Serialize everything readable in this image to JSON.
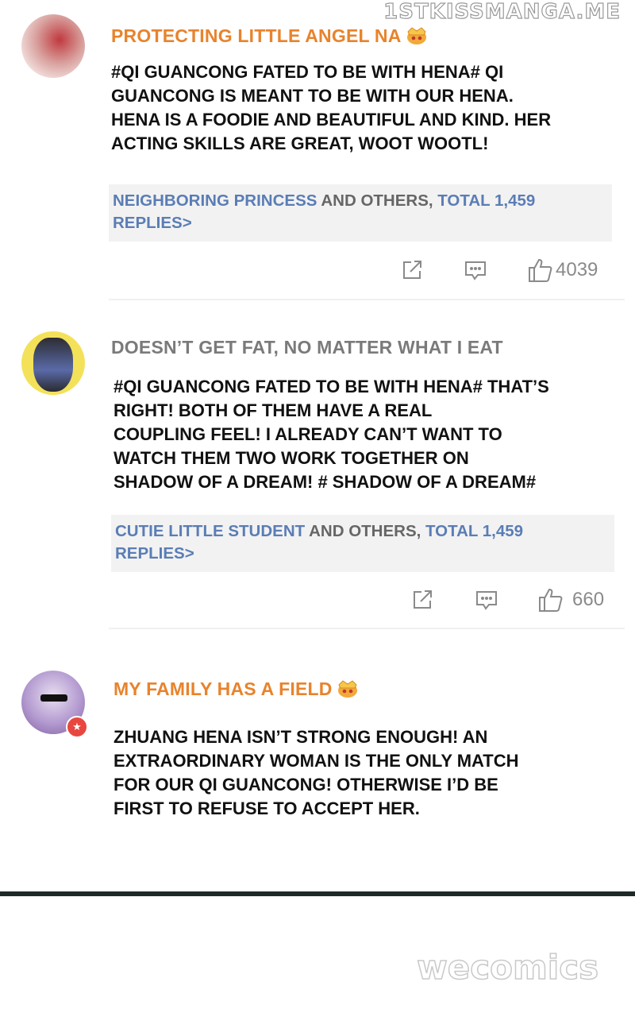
{
  "watermark": "1STKISSMANGA.ME",
  "logo": "wecomics",
  "colors": {
    "vip_name": "#e8832c",
    "normal_name": "#7a7a7a",
    "link": "#5a7db5",
    "reply_bg": "#f2f2f2"
  },
  "posts": [
    {
      "username": "PROTECTING LITTLE ANGEL NA",
      "badge": "crown-icon",
      "text": [
        "#QI GUANCONG FATED TO BE WITH HENA# QI",
        "GUANCONG IS MEANT TO BE WITH OUR HENA.",
        "HENA IS A FOODIE AND BEAUTIFUL AND KIND. HER",
        "ACTING SKILLS ARE GREAT, WOOT WOOTL!"
      ],
      "replies": {
        "user": "NEIGHBORING PRINCESS",
        "middle": " AND OTHERS, ",
        "total": "TOTAL 1,459",
        "tail": "REPLIES>"
      },
      "likes": "4039"
    },
    {
      "username": "DOESN’T GET FAT, NO MATTER WHAT I EAT",
      "text": [
        "#QI GUANCONG FATED TO BE WITH HENA# THAT’S",
        "RIGHT! BOTH OF THEM HAVE A REAL",
        "COUPLING FEEL! I ALREADY CAN’T WANT TO",
        "WATCH THEM TWO WORK TOGETHER ON",
        "SHADOW OF A DREAM! # SHADOW OF A DREAM#"
      ],
      "replies": {
        "user": "CUTIE LITTLE STUDENT",
        "middle": " AND OTHERS, ",
        "total": "TOTAL 1,459",
        "tail": "REPLIES>"
      },
      "likes": "660"
    },
    {
      "username": "MY FAMILY HAS A FIELD",
      "badge": "crown-icon",
      "text": [
        "ZHUANG HENA ISN’T STRONG ENOUGH! AN",
        "EXTRAORDINARY WOMAN IS THE ONLY MATCH",
        "FOR OUR QI GUANCONG! OTHERWISE I’D BE",
        "FIRST TO REFUSE TO ACCEPT HER."
      ]
    }
  ]
}
